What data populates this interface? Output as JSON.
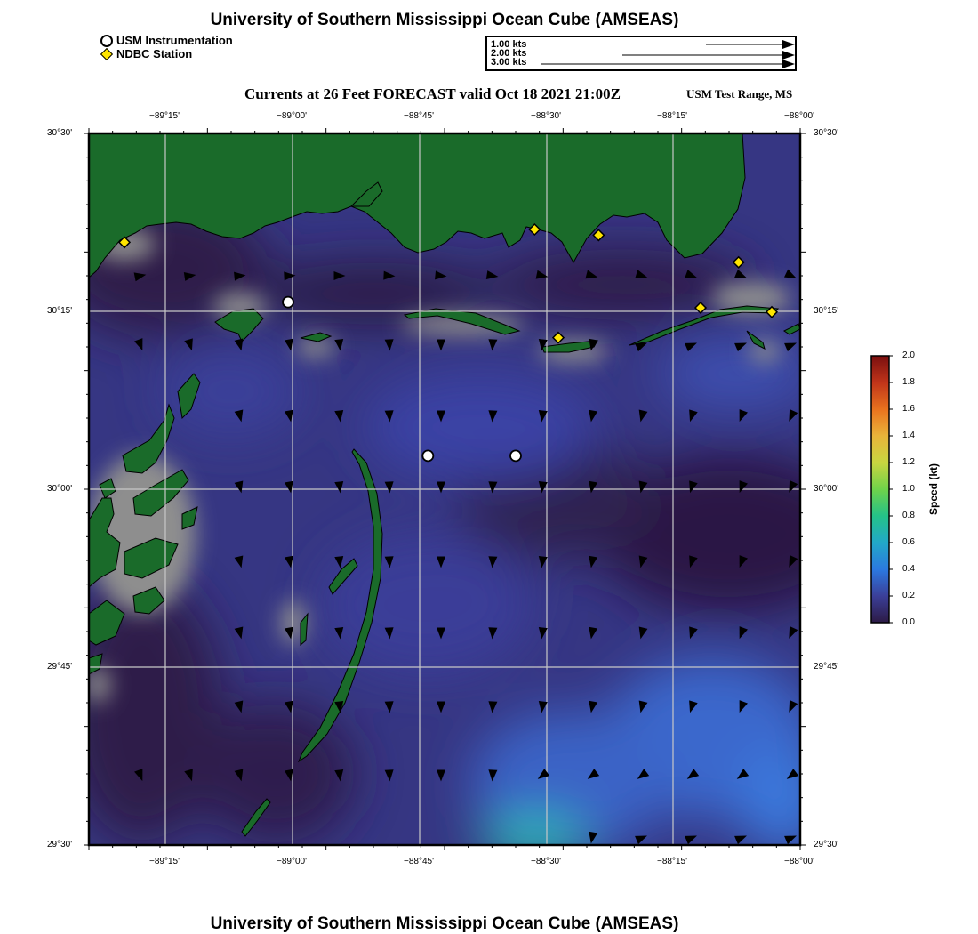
{
  "header": {
    "title": "University of Southern Mississippi Ocean Cube (AMSEAS)",
    "subtitle": "Currents at 26 Feet FORECAST valid Oct 18 2021 21:00Z",
    "range_label": "USM Test Range, MS"
  },
  "footer": {
    "title": "University of Southern Mississippi Ocean Cube (AMSEAS)"
  },
  "legend": {
    "items": [
      {
        "label": "USM Instrumentation",
        "symbol": "circle"
      },
      {
        "label": "NDBC Station",
        "symbol": "diamond"
      }
    ]
  },
  "vector_scale": {
    "labels": [
      "1.00 kts",
      "2.00 kts",
      "3.00 kts"
    ]
  },
  "map": {
    "lon_ticks": [
      "−89°15'",
      "−89°00'",
      "−88°45'",
      "−88°30'",
      "−88°15'",
      "−88°00'"
    ],
    "lat_ticks": [
      "30°30'",
      "30°15'",
      "30°00'",
      "29°45'",
      "29°30'"
    ],
    "colors": {
      "land": "#1a6b2a",
      "shoal": "#8d8d8d",
      "water_dark": "#2c1a45",
      "water_mid": "#3b3f99",
      "water_light": "#3a6fd6",
      "grid": "#c8c8c8"
    },
    "usm_instruments": [
      {
        "lon": -89.08,
        "lat": 30.263
      },
      {
        "lon": -88.785,
        "lat": 30.047
      },
      {
        "lon": -88.6,
        "lat": 30.047
      }
    ],
    "ndbc_stations": [
      {
        "lon": -89.425,
        "lat": 30.347
      },
      {
        "lon": -88.56,
        "lat": 30.365
      },
      {
        "lon": -88.51,
        "lat": 30.213
      },
      {
        "lon": -88.425,
        "lat": 30.357
      },
      {
        "lon": -88.21,
        "lat": 30.255
      },
      {
        "lon": -88.13,
        "lat": 30.319
      },
      {
        "lon": -88.06,
        "lat": 30.249
      }
    ]
  },
  "colorbar": {
    "label": "Speed (kt)",
    "ticks": [
      "2.0",
      "1.8",
      "1.6",
      "1.4",
      "1.2",
      "1.0",
      "0.8",
      "0.6",
      "0.4",
      "0.2",
      "0.0"
    ],
    "colors": [
      "#7a0f0f",
      "#c0341a",
      "#e8721e",
      "#e8b43a",
      "#c9d640",
      "#6fd24a",
      "#24c288",
      "#22a8c8",
      "#2b79e0",
      "#3b3f99",
      "#2c1a45"
    ]
  }
}
